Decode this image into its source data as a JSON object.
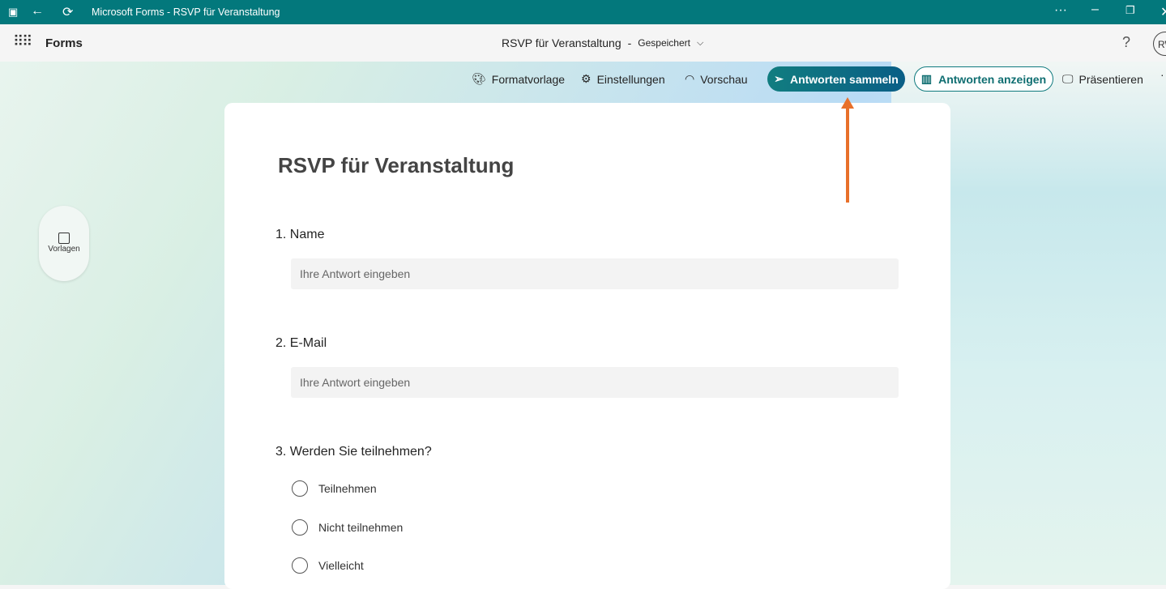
{
  "window": {
    "title": "Microsoft Forms - RSVP für Veranstaltung"
  },
  "appbar": {
    "app_name": "Forms",
    "doc_title": "RSVP für Veranstaltung",
    "separator": "-",
    "save_status": "Gespeichert",
    "help": "?",
    "avatar": "RW"
  },
  "toolbar": {
    "style": "Formatvorlage",
    "settings": "Einstellungen",
    "preview": "Vorschau",
    "collect": "Antworten sammeln",
    "view_responses": "Antworten anzeigen",
    "present": "Präsentieren"
  },
  "sidebar": {
    "templates": "Vorlagen"
  },
  "form": {
    "title": "RSVP für Veranstaltung",
    "questions": [
      {
        "label": "1. Name",
        "placeholder": "Ihre Antwort eingeben"
      },
      {
        "label": "2. E-Mail",
        "placeholder": "Ihre Antwort eingeben"
      },
      {
        "label": "3. Werden Sie teilnehmen?",
        "options": [
          "Teilnehmen",
          "Nicht teilnehmen",
          "Vielleicht"
        ]
      }
    ]
  },
  "colors": {
    "titlebar": "#03787c",
    "accent": "#0f7a7e",
    "annotation_arrow": "#e8702a"
  }
}
